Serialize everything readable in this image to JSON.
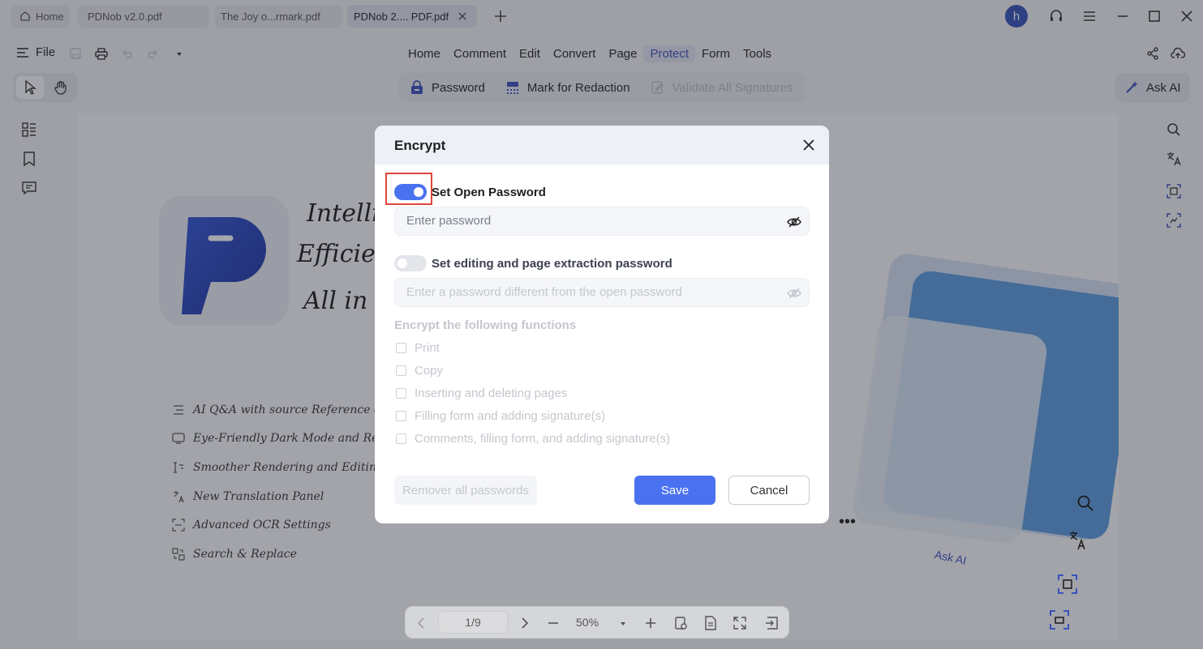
{
  "tabs": {
    "home": "Home",
    "items": [
      "PDNob v2.0.pdf",
      "The Joy o...rmark.pdf",
      "PDNob 2.... PDF.pdf"
    ]
  },
  "user": {
    "avatar_letter": "h"
  },
  "menubar": {
    "file": "File",
    "main_tabs": [
      "Home",
      "Comment",
      "Edit",
      "Convert",
      "Page",
      "Protect",
      "Form",
      "Tools"
    ],
    "active_tab": "Protect"
  },
  "protect_toolbar": {
    "password": "Password",
    "redaction": "Mark for Redaction",
    "validate": "Validate All Signatures"
  },
  "ask_ai": "Ask AI",
  "document": {
    "headline_lines": [
      "Intelli",
      "Efficien",
      "All in"
    ],
    "features": [
      "AI Q&A with source Reference &",
      "Eye-Friendly Dark Mode and Re",
      "Smoother Rendering and Editing",
      "New Translation Panel",
      "Advanced OCR Settings",
      "Search & Replace"
    ],
    "art_chip": "Ask AI",
    "art_more": "•••"
  },
  "bottombar": {
    "page": "1/9",
    "zoom": "50%"
  },
  "dialog": {
    "title": "Encrypt",
    "open_password": {
      "label": "Set Open Password",
      "enabled": true,
      "value": "",
      "placeholder": "Enter password"
    },
    "edit_password": {
      "label": "Set editing and page extraction password",
      "enabled": false,
      "value": "",
      "placeholder": "Enter a password different from the open password"
    },
    "functions_title": "Encrypt the following functions",
    "functions": [
      "Print",
      "Copy",
      "Inserting and deleting pages",
      "Filling form and adding signature(s)",
      "Comments, filling form, and adding signature(s)"
    ],
    "remove_all": "Remover all passwords",
    "save": "Save",
    "cancel": "Cancel"
  },
  "colors": {
    "accent": "#4a72f0",
    "active_tab_text": "#3a4fbd",
    "avatar": "#3550b8",
    "highlight": "#e0453a"
  }
}
